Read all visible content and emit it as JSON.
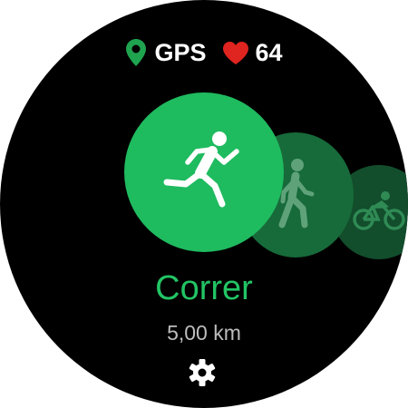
{
  "status": {
    "gps_label": "GPS",
    "heart_rate": "64"
  },
  "activities": [
    {
      "name": "Correr",
      "icon": "running-icon",
      "selected": true
    },
    {
      "name": "Caminar",
      "icon": "walking-icon",
      "selected": false
    },
    {
      "name": "Ciclismo",
      "icon": "cycling-icon",
      "selected": false
    }
  ],
  "selected": {
    "name": "Correr",
    "target": "5,00 km"
  },
  "colors": {
    "accent": "#1fbb5f",
    "accent_text": "#22c464",
    "gps_icon": "#1fa34f",
    "heart_icon": "#e0241f"
  }
}
